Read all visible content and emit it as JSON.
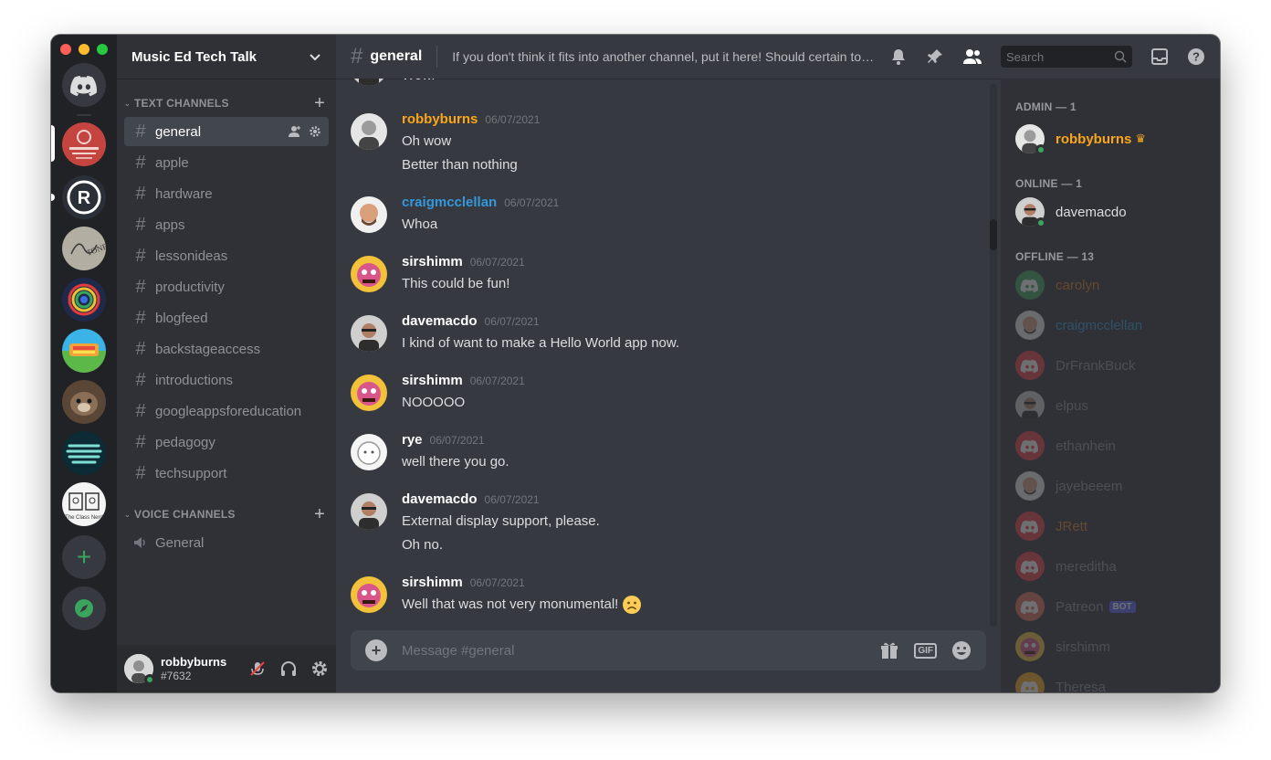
{
  "server": {
    "name": "Music Ed Tech Talk",
    "text_category": "Text Channels",
    "voice_category": "Voice Channels",
    "text_channels": [
      {
        "name": "general"
      },
      {
        "name": "apple"
      },
      {
        "name": "hardware"
      },
      {
        "name": "apps"
      },
      {
        "name": "lessonideas"
      },
      {
        "name": "productivity"
      },
      {
        "name": "blogfeed"
      },
      {
        "name": "backstageaccess"
      },
      {
        "name": "introductions"
      },
      {
        "name": "googleappsforeducation"
      },
      {
        "name": "pedagogy"
      },
      {
        "name": "techsupport"
      }
    ],
    "voice_channels": [
      {
        "name": "General"
      }
    ]
  },
  "user": {
    "name": "robbyburns",
    "tag": "#7632"
  },
  "channel": {
    "name": "general",
    "topic": "If you don't think it fits into another channel, put it here! Should certain topics become popular, new channels will be created.",
    "search_placeholder": "Search"
  },
  "messages": [
    {
      "author": "",
      "time": "",
      "lines": [
        "Wow."
      ],
      "color": "#ffffff"
    },
    {
      "author": "robbyburns",
      "time": "06/07/2021",
      "lines": [
        "Oh wow",
        "Better than nothing"
      ],
      "color": "#faa61a"
    },
    {
      "author": "craigmcclellan",
      "time": "06/07/2021",
      "lines": [
        "Whoa"
      ],
      "color": "#3498db"
    },
    {
      "author": "sirshimm",
      "time": "06/07/2021",
      "lines": [
        "This could be fun!"
      ],
      "color": "#ffffff"
    },
    {
      "author": "davemacdo",
      "time": "06/07/2021",
      "lines": [
        "I kind of want to make a Hello World app now."
      ],
      "color": "#ffffff"
    },
    {
      "author": "sirshimm",
      "time": "06/07/2021",
      "lines": [
        "NOOOOO"
      ],
      "color": "#ffffff"
    },
    {
      "author": "rye",
      "time": "06/07/2021",
      "lines": [
        "well there you go."
      ],
      "color": "#ffffff"
    },
    {
      "author": "davemacdo",
      "time": "06/07/2021",
      "lines": [
        "External display support, please.",
        "Oh no."
      ],
      "color": "#ffffff"
    },
    {
      "author": "sirshimm",
      "time": "06/07/2021",
      "lines": [
        "Well that was not very monumental!"
      ],
      "color": "#ffffff"
    }
  ],
  "composer": {
    "placeholder": "Message #general",
    "gif_label": "GIF"
  },
  "members": {
    "groups": [
      {
        "label": "Admin — 1",
        "members": [
          {
            "name": "robbyburns",
            "color": "#faa61a",
            "crown": true,
            "online": true
          }
        ]
      },
      {
        "label": "Online — 1",
        "members": [
          {
            "name": "davemacdo",
            "color": "#dcddde",
            "online": true
          }
        ]
      },
      {
        "label": "Offline — 13",
        "members": [
          {
            "name": "carolyn",
            "color": "#e67e22"
          },
          {
            "name": "craigmcclellan",
            "color": "#3498db"
          },
          {
            "name": "DrFrankBuck",
            "color": "#8e9297"
          },
          {
            "name": "elpus",
            "color": "#8e9297"
          },
          {
            "name": "ethanhein",
            "color": "#8e9297"
          },
          {
            "name": "jayebeeem",
            "color": "#8e9297"
          },
          {
            "name": "JRett",
            "color": "#e67e22"
          },
          {
            "name": "mereditha",
            "color": "#8e9297"
          },
          {
            "name": "Patreon",
            "color": "#8e9297",
            "bot": "BOT"
          },
          {
            "name": "sirshimm",
            "color": "#8e9297"
          },
          {
            "name": "Theresa",
            "color": "#8e9297"
          }
        ]
      }
    ]
  },
  "colors": {
    "accent": "#5865f2",
    "online": "#3ba55d",
    "admin": "#faa61a",
    "link_blue": "#3498db"
  },
  "icons": {
    "home": "discord-logo-icon",
    "bell": "bell-icon",
    "pin": "pin-icon",
    "members": "members-icon",
    "inbox": "inbox-icon",
    "help": "help-icon"
  }
}
